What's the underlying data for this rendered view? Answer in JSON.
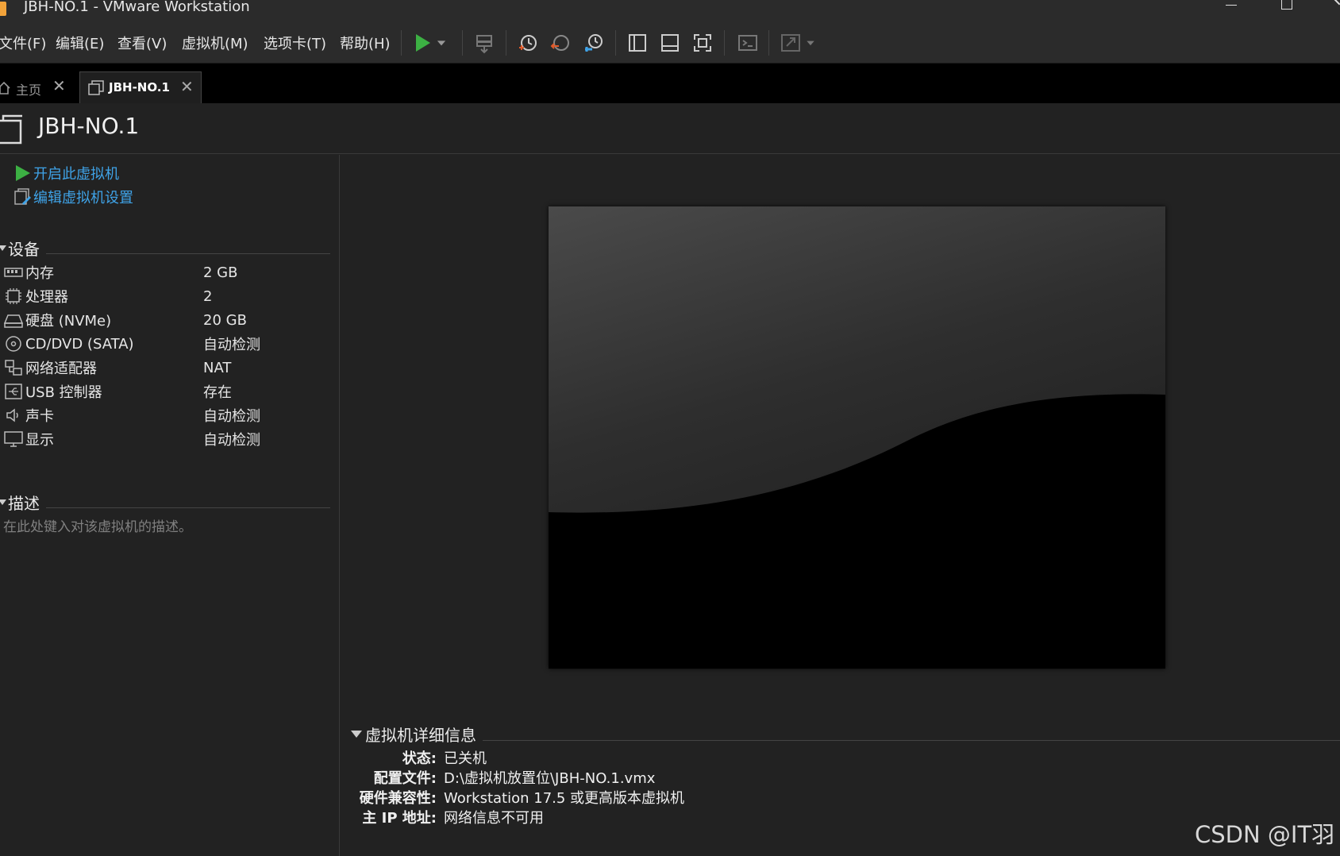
{
  "window": {
    "title": "JBH-NO.1 - VMware Workstation"
  },
  "menu": {
    "file": "文件(F)",
    "edit": "编辑(E)",
    "view": "查看(V)",
    "vm": "虚拟机(M)",
    "tabs": "选项卡(T)",
    "help": "帮助(H)"
  },
  "toolbar": {
    "icons": [
      "play-icon",
      "dropdown-icon",
      "send-ctrl-alt-del-icon",
      "snapshot-icon",
      "revert-snapshot-icon",
      "snapshot-manager-icon",
      "library-view-icon",
      "thumbnail-view-icon",
      "fullscreen-icon",
      "console-icon",
      "unity-icon"
    ]
  },
  "tabs": [
    {
      "label": "主页"
    },
    {
      "label": "JBH-NO.1"
    }
  ],
  "vm": {
    "name": "JBH-NO.1"
  },
  "actions": {
    "power_on": "开启此虚拟机",
    "edit_settings": "编辑虚拟机设置"
  },
  "devices": {
    "heading": "设备",
    "items": [
      {
        "name": "内存",
        "value": "2 GB",
        "icon": "memory-icon"
      },
      {
        "name": "处理器",
        "value": "2",
        "icon": "cpu-icon"
      },
      {
        "name": "硬盘 (NVMe)",
        "value": "20 GB",
        "icon": "hard-disk-icon"
      },
      {
        "name": "CD/DVD (SATA)",
        "value": "自动检测",
        "icon": "cd-dvd-icon"
      },
      {
        "name": "网络适配器",
        "value": "NAT",
        "icon": "network-adapter-icon"
      },
      {
        "name": "USB 控制器",
        "value": "存在",
        "icon": "usb-icon"
      },
      {
        "name": "声卡",
        "value": "自动检测",
        "icon": "sound-icon"
      },
      {
        "name": "显示",
        "value": "自动检测",
        "icon": "display-icon"
      }
    ]
  },
  "description": {
    "heading": "描述",
    "placeholder": "在此处键入对该虚拟机的描述。"
  },
  "details": {
    "heading": "虚拟机详细信息",
    "rows": [
      {
        "key": "状态:",
        "value": "已关机"
      },
      {
        "key": "配置文件:",
        "value": "D:\\虚拟机放置位\\JBH-NO.1.vmx"
      },
      {
        "key": "硬件兼容性:",
        "value": "Workstation 17.5 或更高版本虚拟机"
      },
      {
        "key": "主 IP 地址:",
        "value": "网络信息不可用"
      }
    ]
  },
  "watermark": "CSDN @IT羽",
  "colors": {
    "accent_link": "#3fa3e8",
    "play_green": "#3cb043",
    "background": "#222222"
  }
}
